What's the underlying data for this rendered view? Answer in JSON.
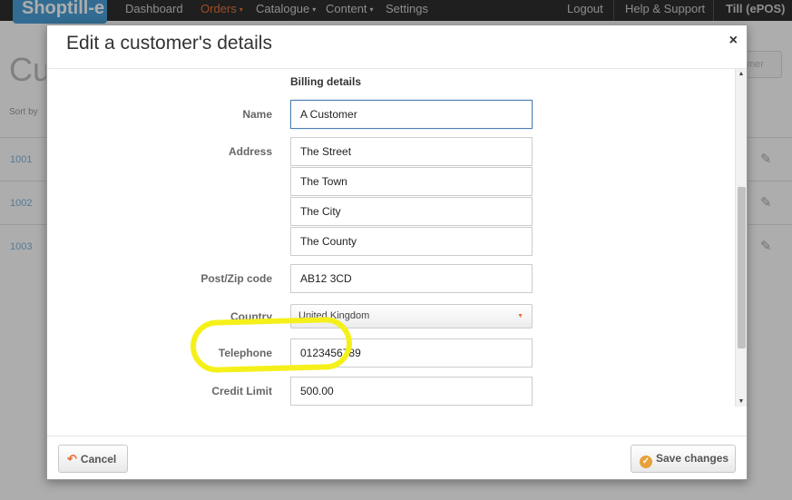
{
  "app": {
    "logo_text": "Shoptill-e"
  },
  "nav": {
    "items": [
      {
        "label": "Dashboard",
        "active": false
      },
      {
        "label": "Orders",
        "active": true,
        "caret": "▾"
      },
      {
        "label": "Catalogue",
        "active": false,
        "caret": "▾"
      },
      {
        "label": "Content",
        "active": false,
        "caret": "▾"
      },
      {
        "label": "Settings",
        "active": false
      }
    ],
    "right": [
      {
        "label": "Logout"
      },
      {
        "label": "Help & Support"
      },
      {
        "label": "Till (ePOS)"
      }
    ]
  },
  "background": {
    "title": "Cu",
    "sort_by": "Sort by",
    "add_button_fragment": "mer",
    "rows": [
      {
        "id": "1001"
      },
      {
        "id": "1002"
      },
      {
        "id": "1003"
      }
    ]
  },
  "modal": {
    "title": "Edit a customer's details",
    "close": "×",
    "section_heading": "Billing details",
    "labels": {
      "name": "Name",
      "address": "Address",
      "postcode": "Post/Zip code",
      "country": "Country",
      "telephone": "Telephone",
      "credit_limit": "Credit Limit"
    },
    "values": {
      "name": "A Customer",
      "address_1": "The Street",
      "address_2": "The Town",
      "address_3": "The City",
      "address_4": "The County",
      "postcode": "AB12 3CD",
      "country": "United Kingdom",
      "telephone": "0123456789",
      "credit_limit": "500.00"
    },
    "buttons": {
      "cancel": "Cancel",
      "save": "Save changes"
    }
  },
  "colors": {
    "accent": "#e8723a",
    "highlight": "#f5f01a",
    "nav_bg": "#2f2f2f",
    "focus_border": "#4a7fb5"
  }
}
